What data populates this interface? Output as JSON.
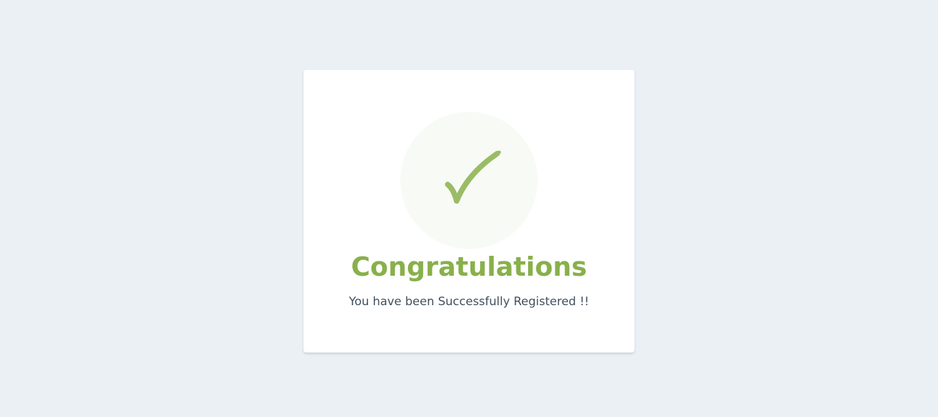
{
  "card": {
    "icon": "checkmark-icon",
    "title": "Congratulations",
    "message": "You have been Successfully Registered !!"
  },
  "colors": {
    "background": "#ebf0f5",
    "card": "#ffffff",
    "accent": "#88b04b",
    "icon_circle": "#f8faf5",
    "message_text": "#404f5e"
  }
}
